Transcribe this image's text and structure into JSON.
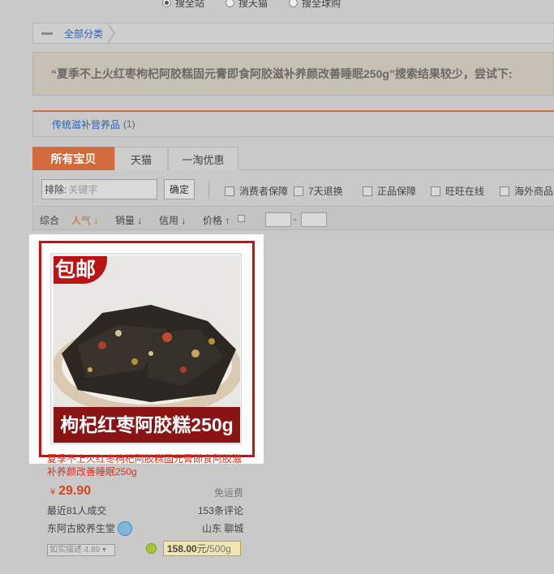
{
  "search_scope": {
    "options": [
      "搜全站",
      "搜天猫",
      "搜全球购"
    ],
    "selected_index": 0
  },
  "breadcrumb": {
    "label": "全部分类"
  },
  "notice": {
    "text": "“夏季不上火红枣枸杞阿胶糕固元膏即食阿胶滋补养颜改善睡眠250g”搜索结果较少，尝试下:"
  },
  "category": {
    "name": "传统滋补营养品",
    "count": "(1)"
  },
  "tabs": [
    {
      "label": "所有宝贝",
      "active": true
    },
    {
      "label": "天猫",
      "active": false
    },
    {
      "label": "一淘优惠",
      "active": false
    }
  ],
  "filter": {
    "exclude_label": "排除:",
    "exclude_placeholder": "关键字",
    "confirm_label": "确定",
    "checkboxes": [
      "消费者保障",
      "7天退换",
      "正品保障",
      "旺旺在线",
      "海外商品"
    ]
  },
  "sort": {
    "items": [
      "综合",
      "人气",
      "销量",
      "信用",
      "价格"
    ],
    "active": "人气",
    "price_dash": "-"
  },
  "item": {
    "image_corner_text": "包邮",
    "image_banner_text": "枸杞红枣阿胶糕250g",
    "title": "夏季不上火红枣枸杞阿胶糕固元膏即食阿胶滋补养颜改善睡眠250g",
    "currency": "¥",
    "price": "29.90",
    "shipping": "免运费",
    "sales": "最近81人成交",
    "reviews": "153条评论",
    "shop": "东阿古胶养生堂",
    "location": "山东 聊城",
    "rating": "如实描述:4.89",
    "unit_price": "158.00",
    "unit_yuan": "元/",
    "unit_qty": "500g"
  },
  "colors": {
    "accent": "#d36a3c",
    "link": "#2a62b8",
    "price": "#d8421c",
    "highlight_frame": "#d40c0c"
  }
}
